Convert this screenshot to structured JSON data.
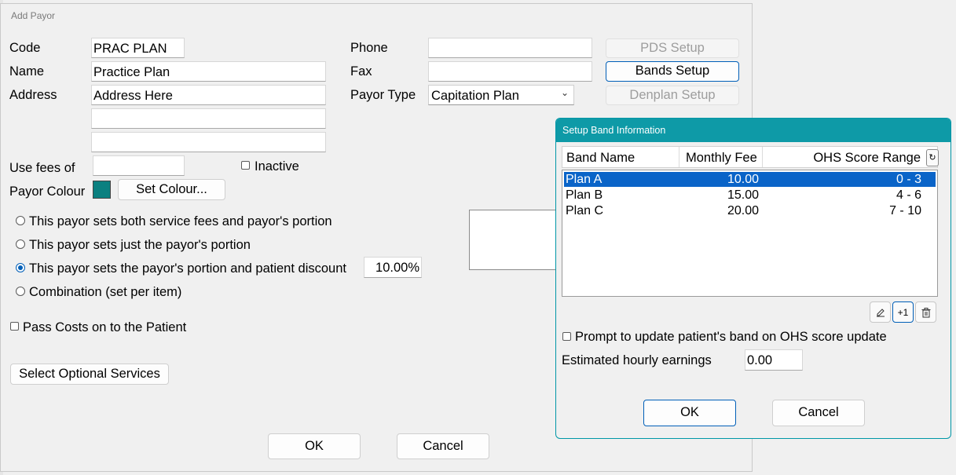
{
  "payor": {
    "title": "Add Payor",
    "code_label": "Code",
    "code_value": "PRAC PLAN",
    "name_label": "Name",
    "name_value": "Practice Plan",
    "address_label": "Address",
    "address1": "Address Here",
    "address2": "",
    "address3": "",
    "use_fees_label": "Use fees of",
    "use_fees_value": "",
    "inactive_label": "Inactive",
    "colour_label": "Payor Colour",
    "colour_value": "#0b8080",
    "set_colour_label": "Set Colour...",
    "phone_label": "Phone",
    "phone_value": "",
    "fax_label": "Fax",
    "fax_value": "",
    "type_label": "Payor Type",
    "type_value": "Capitation Plan",
    "pds_setup": "PDS Setup",
    "bands_setup": "Bands Setup",
    "denplan_setup": "Denplan Setup",
    "radio_options": [
      "This payor sets both service fees and payor's portion",
      "This payor sets just the payor's portion",
      "This payor sets the payor's portion and patient discount",
      "Combination (set per item)"
    ],
    "selected_radio": 2,
    "discount_value": "10.00%",
    "pass_costs_label": "Pass Costs on to the Patient",
    "optional_services_label": "Select Optional Services",
    "ok_label": "OK",
    "cancel_label": "Cancel"
  },
  "bands": {
    "title": "Setup Band Information",
    "columns": [
      "Band Name",
      "Monthly Fee",
      "OHS Score Range"
    ],
    "rows": [
      {
        "name": "Plan A",
        "fee": "10.00",
        "range": "0 - 3"
      },
      {
        "name": "Plan B",
        "fee": "15.00",
        "range": "4 - 6"
      },
      {
        "name": "Plan C",
        "fee": "20.00",
        "range": "7 - 10"
      }
    ],
    "selected_row": 0,
    "plus_one_label": "+1",
    "prompt_label": "Prompt to update patient's band on OHS score update",
    "earnings_label": "Estimated hourly earnings",
    "earnings_value": "0.00",
    "ok_label": "OK",
    "cancel_label": "Cancel"
  },
  "colors": {
    "accent": "#005fb8",
    "titlebar": "#0e9aa7",
    "selection": "#0a64c8"
  }
}
